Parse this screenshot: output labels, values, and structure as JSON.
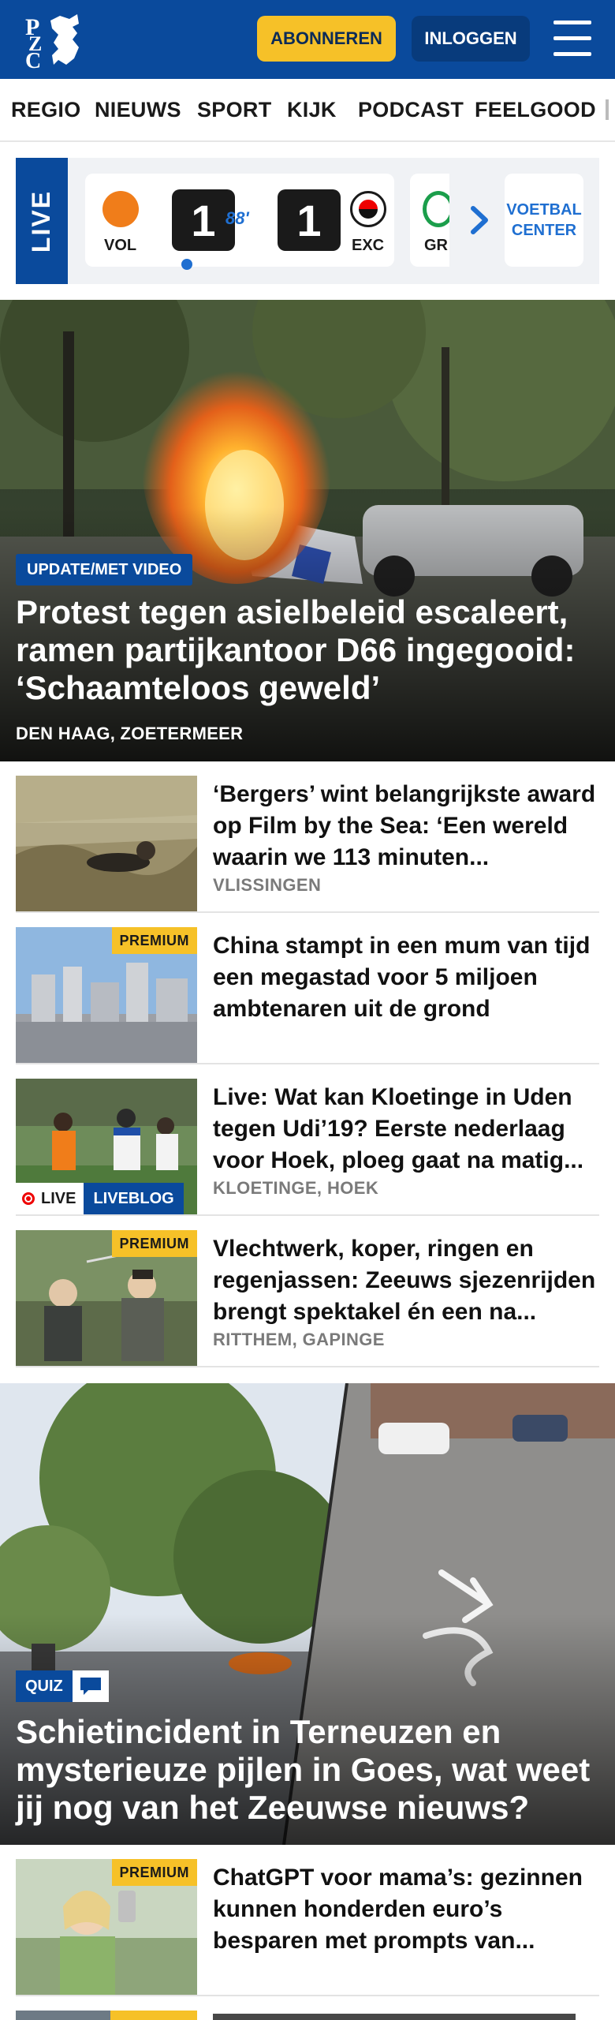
{
  "header": {
    "logo_text": "PZC",
    "subscribe_label": "ABONNEREN",
    "login_label": "INLOGGEN"
  },
  "nav": {
    "items": [
      "REGIO",
      "NIEUWS",
      "SPORT",
      "KIJK",
      "PODCAST",
      "FEELGOOD"
    ]
  },
  "live": {
    "tab_label": "LIVE",
    "match": {
      "home": "VOL",
      "away": "EXC",
      "home_score": "1",
      "away_score": "1",
      "minute": "88'"
    },
    "next_match_abbr": "GR",
    "center_label_line1": "VOETBAL",
    "center_label_line2": "CENTER"
  },
  "hero": {
    "badge": "UPDATE/MET VIDEO",
    "title": "Protest tegen asielbeleid escaleert, ramen partijkantoor D66 ingegooid: ‘Schaamteloos geweld’",
    "location": "DEN HAAG, ZOETERMEER"
  },
  "articles": [
    {
      "title": "‘Bergers’ wint belangrijkste award op Film by the Sea: ‘Een wereld waarin we 113 minuten...",
      "location": "VLISSINGEN",
      "premium": ""
    },
    {
      "title": "China stampt in een mum van tijd een megastad voor 5 miljoen ambtenaren uit de grond",
      "location": "",
      "premium": "PREMIUM"
    },
    {
      "title": "Live: Wat kan Kloetinge in Uden tegen Udi’19? Eerste nederlaag voor Hoek, ploeg gaat na matig...",
      "location": "KLOETINGE, HOEK",
      "premium": "",
      "live_label": "LIVE",
      "liveblog_label": "LIVEBLOG"
    },
    {
      "title": "Vlechtwerk, koper, ringen en regenjassen: Zeeuws sjezenrij­den brengt spektakel én een na...",
      "location": "RITTHEM, GAPINGE",
      "premium": "PREMIUM"
    }
  ],
  "quiz": {
    "badge": "QUIZ",
    "title": "Schietincident in Terneuzen en mysterieuze pijlen in Goes, wat weet jij nog van het Zeeuwse nieuws?"
  },
  "article_bottom": {
    "title": "ChatGPT voor mama’s: gezinnen kunnen honderden euro’s besparen met prompts van...",
    "premium": "PREMIUM"
  },
  "colors": {
    "brand_blue": "#0a4a9c",
    "accent_yellow": "#f6c128",
    "live_blue": "#1f6fd1"
  }
}
